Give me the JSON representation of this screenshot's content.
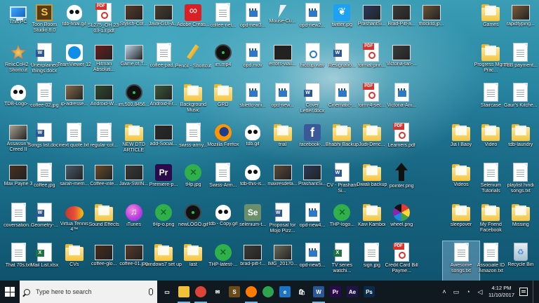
{
  "desktop_icons": [
    {
      "label": "This PC",
      "kind": "pc",
      "col": 0,
      "row": 0,
      "color": ""
    },
    {
      "label": "Toon Boom Studio 8.0",
      "kind": "toon",
      "col": 1,
      "row": 0,
      "color": ""
    },
    {
      "label": "tdb-final.gif",
      "kind": "skull",
      "col": 2,
      "row": 0,
      "color": ""
    },
    {
      "label": "SL275_OH 23-03-13.pdf",
      "kind": "pdf",
      "col": 3,
      "row": 0,
      "color": ""
    },
    {
      "label": "Stylish-Cof...",
      "kind": "photo",
      "col": 4,
      "row": 0,
      "color": "#5a3b2a"
    },
    {
      "label": "Java-GUI-A...",
      "kind": "photo",
      "col": 5,
      "row": 0,
      "color": "#4a3e2e"
    },
    {
      "label": "Adobe Creati...",
      "kind": "adobecc",
      "col": 6,
      "row": 0,
      "color": ""
    },
    {
      "label": "coffee-net...",
      "kind": "file",
      "col": 7,
      "row": 0,
      "color": ""
    },
    {
      "label": "opd-new3...",
      "kind": "video",
      "col": 8,
      "row": 0,
      "color": ""
    },
    {
      "label": "Mouse-Cu...",
      "kind": "cursor",
      "col": 9,
      "row": 0,
      "color": ""
    },
    {
      "label": "opd-new2...",
      "kind": "video",
      "col": 10,
      "row": 0,
      "color": ""
    },
    {
      "label": "twitter.jpg",
      "kind": "tw",
      "col": 11,
      "row": 0,
      "color": ""
    },
    {
      "label": "PrashantSi...",
      "kind": "photo",
      "col": 12,
      "row": 0,
      "color": "#2b3a5c"
    },
    {
      "label": "Brad-Pitt-a...",
      "kind": "photo",
      "col": 13,
      "row": 0,
      "color": "#3d3a36"
    },
    {
      "label": "thocktd.jp...",
      "kind": "photo",
      "col": 14,
      "row": 0,
      "color": "#6a5236"
    },
    {
      "label": "Games",
      "kind": "folder",
      "col": 16,
      "row": 0,
      "color": ""
    },
    {
      "label": "rapidtyping...",
      "kind": "photo",
      "col": 17,
      "row": 0,
      "color": "#7c5b3a"
    },
    {
      "label": "RelicCoH2 - Shortcut",
      "kind": "relic",
      "col": 0,
      "row": 1,
      "color": ""
    },
    {
      "label": "Unexplained things.docx",
      "kind": "doc",
      "col": 1,
      "row": 1,
      "color": ""
    },
    {
      "label": "TeamViewer 12",
      "kind": "teamviewer",
      "col": 2,
      "row": 1,
      "color": ""
    },
    {
      "label": "Hitman Absoluti...",
      "kind": "photo",
      "col": 3,
      "row": 1,
      "color": "#6b1d1d"
    },
    {
      "label": "Game.of.T...",
      "kind": "photo",
      "col": 4,
      "row": 1,
      "color": "#bcd4e6"
    },
    {
      "label": "coffee-pad...",
      "kind": "file",
      "col": 5,
      "row": 1,
      "color": ""
    },
    {
      "label": "Pencil - Shortcut",
      "kind": "pencil",
      "col": 6,
      "row": 1,
      "color": ""
    },
    {
      "label": "im.mp4",
      "kind": "black",
      "col": 7,
      "row": 1,
      "color": ""
    },
    {
      "label": "opd.mov",
      "kind": "video",
      "col": 8,
      "row": 1,
      "color": ""
    },
    {
      "label": "errors-wall...",
      "kind": "photo",
      "col": 9,
      "row": 1,
      "color": "#222222"
    },
    {
      "label": "hiccup.wav",
      "kind": "audio",
      "col": 10,
      "row": 1,
      "color": ""
    },
    {
      "label": "Resignatio...",
      "kind": "doc",
      "col": 11,
      "row": 1,
      "color": ""
    },
    {
      "label": "format-prin...",
      "kind": "pdf",
      "col": 12,
      "row": 1,
      "color": ""
    },
    {
      "label": "Victoria-fan-...",
      "kind": "photo",
      "col": 13,
      "row": 1,
      "color": "#3b3b3b"
    },
    {
      "label": "Progress Mgmt Prac...",
      "kind": "folder",
      "col": 16,
      "row": 1,
      "color": ""
    },
    {
      "label": "TBB payment...",
      "kind": "file",
      "col": 17,
      "row": 1,
      "color": ""
    },
    {
      "label": "TDB-Logo-...",
      "kind": "skull",
      "col": 0,
      "row": 2,
      "color": ""
    },
    {
      "label": "coffee-02.jpg",
      "kind": "file",
      "col": 1,
      "row": 2,
      "color": ""
    },
    {
      "label": "ip-adresse...",
      "kind": "photo",
      "col": 2,
      "row": 2,
      "color": "#8a6a4a"
    },
    {
      "label": "Android-W...",
      "kind": "photo",
      "col": 3,
      "row": 2,
      "color": "#2e4a2e"
    },
    {
      "label": "im.500.8456...",
      "kind": "black",
      "col": 4,
      "row": 2,
      "color": ""
    },
    {
      "label": "Android-Er...",
      "kind": "photo",
      "col": 5,
      "row": 2,
      "color": "#3a5a3a"
    },
    {
      "label": "Background Music",
      "kind": "folder",
      "col": 6,
      "row": 2,
      "color": ""
    },
    {
      "label": "GRD",
      "kind": "folder",
      "col": 7,
      "row": 2,
      "color": ""
    },
    {
      "label": "stiletto-ani...",
      "kind": "video",
      "col": 8,
      "row": 2,
      "color": ""
    },
    {
      "label": "opd-new...",
      "kind": "video",
      "col": 9,
      "row": 2,
      "color": ""
    },
    {
      "label": "Cover Letter.docx",
      "kind": "doc",
      "col": 10,
      "row": 2,
      "color": ""
    },
    {
      "label": "Cinematic-...",
      "kind": "video",
      "col": 11,
      "row": 2,
      "color": ""
    },
    {
      "label": "form-4-sec...",
      "kind": "pdf",
      "col": 12,
      "row": 2,
      "color": ""
    },
    {
      "label": "Victoria-Ani...",
      "kind": "video",
      "col": 13,
      "row": 2,
      "color": ""
    },
    {
      "label": "Staircase",
      "kind": "file",
      "col": 16,
      "row": 2,
      "color": ""
    },
    {
      "label": "Gaur's Kitche...",
      "kind": "file",
      "col": 17,
      "row": 2,
      "color": ""
    },
    {
      "label": "Assassin's Creed II",
      "kind": "photo",
      "col": 0,
      "row": 3,
      "color": "#a8a090"
    },
    {
      "label": "Songs list.docx",
      "kind": "doc",
      "col": 1,
      "row": 3,
      "color": ""
    },
    {
      "label": "next quote.txt",
      "kind": "file",
      "col": 2,
      "row": 3,
      "color": ""
    },
    {
      "label": "regular-cof...",
      "kind": "file",
      "col": 3,
      "row": 3,
      "color": ""
    },
    {
      "label": "NEW DTD ARTICLE",
      "kind": "folder",
      "col": 4,
      "row": 3,
      "color": ""
    },
    {
      "label": "add-Social...",
      "kind": "photo",
      "col": 5,
      "row": 3,
      "color": "#2a2a2a"
    },
    {
      "label": "swiss-army...",
      "kind": "file",
      "col": 6,
      "row": 3,
      "color": ""
    },
    {
      "label": "Mozilla Firefox",
      "kind": "firefox",
      "col": 7,
      "row": 3,
      "color": ""
    },
    {
      "label": "tdb.gif",
      "kind": "skull",
      "col": 8,
      "row": 3,
      "color": ""
    },
    {
      "label": "trial",
      "kind": "folder",
      "col": 9,
      "row": 3,
      "color": ""
    },
    {
      "label": "facebook-...",
      "kind": "fb",
      "col": 10,
      "row": 3,
      "color": ""
    },
    {
      "label": "Bhabhi Backup",
      "kind": "folder",
      "col": 11,
      "row": 3,
      "color": ""
    },
    {
      "label": "Judi-Denc...",
      "kind": "folder",
      "col": 12,
      "row": 3,
      "color": ""
    },
    {
      "label": "Learners.pdf",
      "kind": "pdf",
      "col": 13,
      "row": 3,
      "color": ""
    },
    {
      "label": "Jia l Baoy",
      "kind": "folder",
      "col": 15,
      "row": 3,
      "color": ""
    },
    {
      "label": "Video",
      "kind": "folder",
      "col": 16,
      "row": 3,
      "color": ""
    },
    {
      "label": "tdb-laundry",
      "kind": "folder",
      "col": 17,
      "row": 3,
      "color": ""
    },
    {
      "label": "Max Payne 3",
      "kind": "photo",
      "col": 0,
      "row": 4,
      "color": "#4a3020"
    },
    {
      "label": "coffee.jpg",
      "kind": "file",
      "col": 1,
      "row": 4,
      "color": ""
    },
    {
      "label": "sarah-mem...",
      "kind": "photo",
      "col": 2,
      "row": 4,
      "color": "#4a5a6a"
    },
    {
      "label": "Coffee-inte...",
      "kind": "photo",
      "col": 3,
      "row": 4,
      "color": "#6a4a2a"
    },
    {
      "label": "Java-SWIN...",
      "kind": "photo",
      "col": 4,
      "row": 4,
      "color": "#3a3a3a"
    },
    {
      "label": "Premiere-p...",
      "kind": "app",
      "col": 5,
      "row": 4,
      "color": "#2a0a4a",
      "text": "Pr"
    },
    {
      "label": "tHp.jpg",
      "kind": "green",
      "col": 6,
      "row": 4,
      "color": ""
    },
    {
      "label": "Swiss-Arm...",
      "kind": "file",
      "col": 7,
      "row": 4,
      "color": ""
    },
    {
      "label": "tdb-this-is...",
      "kind": "skull",
      "col": 8,
      "row": 4,
      "color": ""
    },
    {
      "label": "maxresdefa...",
      "kind": "photo",
      "col": 9,
      "row": 4,
      "color": "#5a4a3a"
    },
    {
      "label": "PrashantSi...",
      "kind": "photo",
      "col": 10,
      "row": 4,
      "color": "#2b3a5c"
    },
    {
      "label": "CV - Prashant Si...",
      "kind": "doc",
      "col": 11,
      "row": 4,
      "color": ""
    },
    {
      "label": "Diwali backup",
      "kind": "folder",
      "col": 12,
      "row": 4,
      "color": ""
    },
    {
      "label": "pointer.png",
      "kind": "arrow",
      "col": 13,
      "row": 4,
      "color": ""
    },
    {
      "label": "Videos",
      "kind": "folder",
      "col": 15,
      "row": 4,
      "color": ""
    },
    {
      "label": "Selenium Tutorials",
      "kind": "file",
      "col": 16,
      "row": 4,
      "color": ""
    },
    {
      "label": "playlist hindi songs.txt",
      "kind": "file",
      "col": 17,
      "row": 4,
      "color": ""
    },
    {
      "label": "coversation...",
      "kind": "file",
      "col": 0,
      "row": 5,
      "color": ""
    },
    {
      "label": "Geometry-...",
      "kind": "doc",
      "col": 1,
      "row": 5,
      "color": ""
    },
    {
      "label": "Virtua Tennis 4™",
      "kind": "tennis",
      "col": 2,
      "row": 5,
      "color": ""
    },
    {
      "label": "Sound Effects",
      "kind": "folder",
      "col": 3,
      "row": 5,
      "color": ""
    },
    {
      "label": "iTunes",
      "kind": "itunes",
      "col": 4,
      "row": 5,
      "color": ""
    },
    {
      "label": "tHp-o.png",
      "kind": "green",
      "col": 5,
      "row": 5,
      "color": ""
    },
    {
      "label": "newLOGO.gif",
      "kind": "black",
      "col": 6,
      "row": 5,
      "color": ""
    },
    {
      "label": "tdb - Copy.gif",
      "kind": "skull",
      "col": 7,
      "row": 5,
      "color": ""
    },
    {
      "label": "selenium-t...",
      "kind": "app",
      "col": 8,
      "row": 5,
      "color": "#6a8f6a",
      "text": "Se"
    },
    {
      "label": "Proposal for Mojo Pizz...",
      "kind": "doc",
      "col": 9,
      "row": 5,
      "color": ""
    },
    {
      "label": "opd-new4...",
      "kind": "video",
      "col": 10,
      "row": 5,
      "color": ""
    },
    {
      "label": "THP-logo...",
      "kind": "green",
      "col": 11,
      "row": 5,
      "color": ""
    },
    {
      "label": "Kavi Kamboi",
      "kind": "folder",
      "col": 12,
      "row": 5,
      "color": ""
    },
    {
      "label": "wheel.png",
      "kind": "pie",
      "col": 13,
      "row": 5,
      "color": ""
    },
    {
      "label": "sleepover",
      "kind": "folder",
      "col": 15,
      "row": 5,
      "color": ""
    },
    {
      "label": "My Friend Facebook",
      "kind": "folder",
      "col": 16,
      "row": 5,
      "color": ""
    },
    {
      "label": "Missing",
      "kind": "folder",
      "col": 17,
      "row": 5,
      "color": ""
    },
    {
      "label": "That 70s.txt",
      "kind": "file",
      "col": 0,
      "row": 6,
      "color": ""
    },
    {
      "label": "Mail List.xlsx",
      "kind": "xls",
      "col": 1,
      "row": 6,
      "color": ""
    },
    {
      "label": "CVs",
      "kind": "folder",
      "col": 2,
      "row": 6,
      "color": ""
    },
    {
      "label": "coffee-glo...",
      "kind": "photo",
      "col": 3,
      "row": 6,
      "color": "#4a2a1a"
    },
    {
      "label": "coffee-01.jpg",
      "kind": "photo",
      "col": 4,
      "row": 6,
      "color": "#5a3a2a"
    },
    {
      "label": "windows7 set up",
      "kind": "folder",
      "col": 5,
      "row": 6,
      "color": ""
    },
    {
      "label": "last",
      "kind": "folder",
      "col": 6,
      "row": 6,
      "color": ""
    },
    {
      "label": "THP-latest-...",
      "kind": "green",
      "col": 7,
      "row": 6,
      "color": ""
    },
    {
      "label": "brad-pitt-f...",
      "kind": "photo",
      "col": 8,
      "row": 6,
      "color": "#3d3a36"
    },
    {
      "label": "IMG_20170...",
      "kind": "photo",
      "col": 9,
      "row": 6,
      "color": "#6a6a5a"
    },
    {
      "label": "opd-new5...",
      "kind": "video",
      "col": 10,
      "row": 6,
      "color": ""
    },
    {
      "label": "TV series watchi...",
      "kind": "xls",
      "col": 11,
      "row": 6,
      "color": ""
    },
    {
      "label": "sign.jpg",
      "kind": "file",
      "col": 12,
      "row": 6,
      "color": ""
    },
    {
      "label": "Credit Card Bill Payme...",
      "kind": "pdf",
      "col": 13,
      "row": 6,
      "color": ""
    },
    {
      "label": "Awesome songs.txt",
      "kind": "file",
      "col": 15,
      "row": 6,
      "color": "",
      "selected": true
    },
    {
      "label": "Associate ID Amazon.txt",
      "kind": "file",
      "col": 16,
      "row": 6,
      "color": ""
    },
    {
      "label": "Recycle Bin",
      "kind": "recycle",
      "col": 17,
      "row": 6,
      "color": ""
    }
  ],
  "taskbar": {
    "search_placeholder": "Type here to search",
    "pinned": [
      {
        "name": "task-view",
        "text": "▭",
        "bg": "#101820",
        "active": false
      },
      {
        "name": "file-explorer",
        "text": "",
        "bg": "#f2c13c",
        "active": true
      },
      {
        "name": "chrome",
        "text": "",
        "bg": "#db4437",
        "active": true
      },
      {
        "name": "mail",
        "text": "✉",
        "bg": "#101820",
        "active": false
      },
      {
        "name": "toon-boom",
        "text": "S",
        "bg": "#6b4a1a",
        "active": false
      },
      {
        "name": "firefox",
        "text": "",
        "bg": "#ff7a00",
        "active": true
      },
      {
        "name": "chrome-2",
        "text": "",
        "bg": "#2ea44f",
        "active": false
      },
      {
        "name": "edge",
        "text": "e",
        "bg": "#1d74c4",
        "active": false
      },
      {
        "name": "store",
        "text": "🛍",
        "bg": "#101820",
        "active": false
      },
      {
        "name": "word",
        "text": "W",
        "bg": "#2b5797",
        "active": true
      },
      {
        "name": "premiere",
        "text": "Pr",
        "bg": "#2a0a4a",
        "active": false
      },
      {
        "name": "after-effects",
        "text": "Ae",
        "bg": "#1f1445",
        "active": false
      },
      {
        "name": "photoshop",
        "text": "Ps",
        "bg": "#0a2a4a",
        "active": false
      }
    ],
    "time": "4:12 PM",
    "date": "11/10/2017"
  }
}
